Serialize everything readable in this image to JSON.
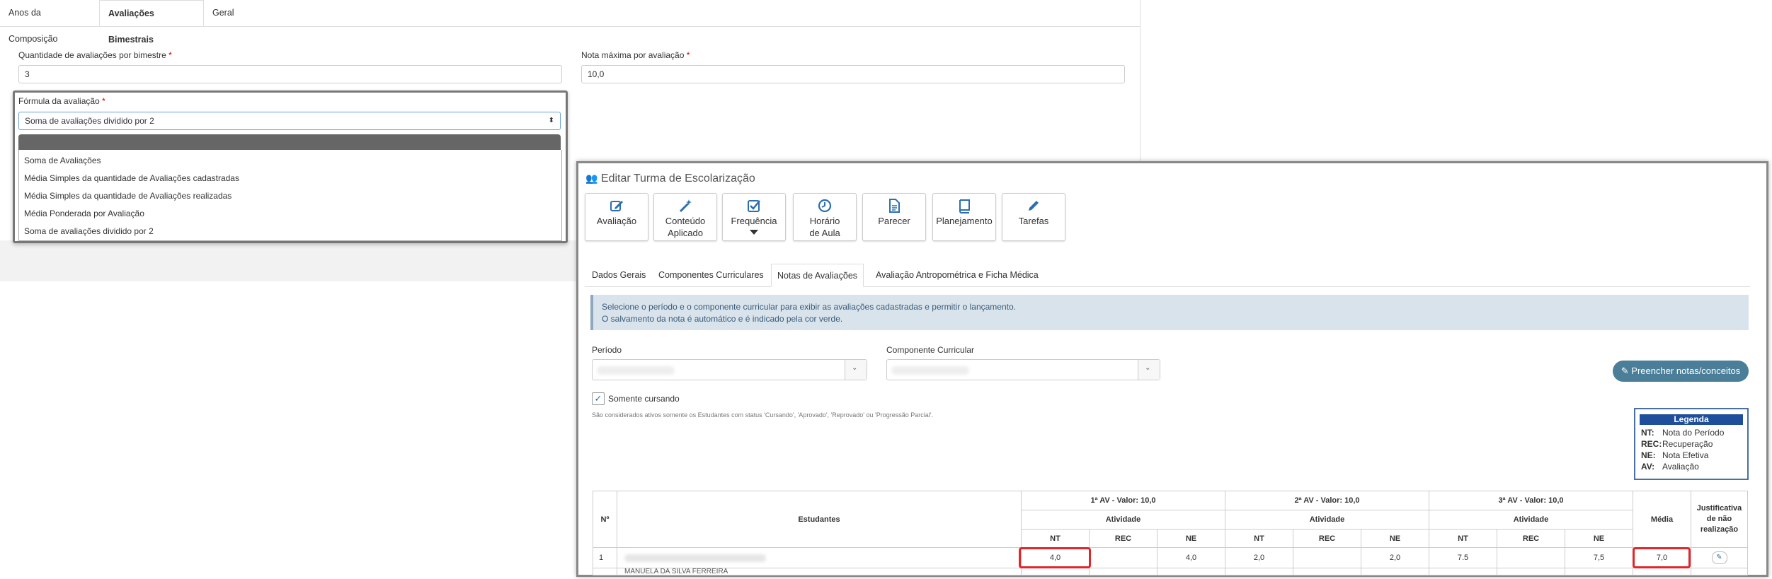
{
  "left_panel": {
    "tabs": [
      "Anos da Composição",
      "Avaliações Bimestrais",
      "Geral"
    ],
    "qty_label": "Quantidade de avaliações por bimestre",
    "qty_value": "3",
    "max_label": "Nota máxima por avaliação",
    "max_value": "10,0",
    "required_mark": "*",
    "formula_label": "Fórmula da avaliação",
    "formula_value": "Soma de avaliações dividido por 2",
    "formula_options": [
      "Soma de Avaliações",
      "Média Simples da quantidade de Avaliações cadastradas",
      "Média Simples da quantidade de Avaliações realizadas",
      "Média Ponderada por Avaliação",
      "Soma de avaliações dividido por 2"
    ]
  },
  "modal": {
    "title": "Editar Turma de Escolarização",
    "toolbar": [
      {
        "label": "Avaliação",
        "icon": "edit-icon"
      },
      {
        "label": "Conteúdo Aplicado",
        "icon": "magic-wand-icon"
      },
      {
        "label": "Frequência",
        "icon": "checkbox-icon"
      },
      {
        "label": "Horário de Aula",
        "icon": "clock-icon"
      },
      {
        "label": "Parecer",
        "icon": "document-icon"
      },
      {
        "label": "Planejamento",
        "icon": "book-icon"
      },
      {
        "label": "Tarefas",
        "icon": "pencil-icon"
      }
    ],
    "tabs": [
      "Dados Gerais",
      "Componentes Curriculares",
      "Notas de Avaliações",
      "Avaliação Antropométrica e Ficha Médica"
    ],
    "info_line1": "Selecione o período e o componente curricular para exibir as avaliações cadastradas e permitir o lançamento.",
    "info_line2": "O salvamento da nota é automático e é indicado pela cor verde.",
    "periodo_label": "Período",
    "componente_label": "Componente Curricular",
    "fill_button": "Preencher notas/conceitos",
    "somente_label": "Somente cursando",
    "note": "São considerados ativos somente os Estudantes com status 'Cursando', 'Aprovado', 'Reprovado' ou 'Progressão Parcial'.",
    "legend": {
      "title": "Legenda",
      "items": [
        {
          "k": "NT:",
          "v": "Nota do Período"
        },
        {
          "k": "REC:",
          "v": "Recuperação"
        },
        {
          "k": "NE:",
          "v": "Nota Efetiva"
        },
        {
          "k": "AV:",
          "v": "Avaliação"
        }
      ]
    },
    "table": {
      "col_n": "Nº",
      "col_students": "Estudantes",
      "av1": "1ª AV - Valor: 10,0",
      "av2": "2ª AV - Valor: 10,0",
      "av3": "3ª AV - Valor: 10,0",
      "activity": "Atividade",
      "nt": "NT",
      "rec": "REC",
      "ne": "NE",
      "media": "Média",
      "justificativa": "Justificativa de não realização",
      "row1": {
        "n": "1",
        "nt1": "4,0",
        "rec1": "",
        "ne1": "4,0",
        "nt2": "2,0",
        "rec2": "",
        "ne2": "2,0",
        "nt3": "7.5",
        "rec3": "",
        "ne3": "7,5",
        "media": "7,0"
      },
      "row2_partial_student": "MANUELA DA SILVA FERREIRA"
    }
  },
  "colors": {
    "accent": "#4a7e99",
    "legend": "#1f4f9a",
    "highlight": "#e0262b",
    "icon": "#2a6fb0"
  }
}
